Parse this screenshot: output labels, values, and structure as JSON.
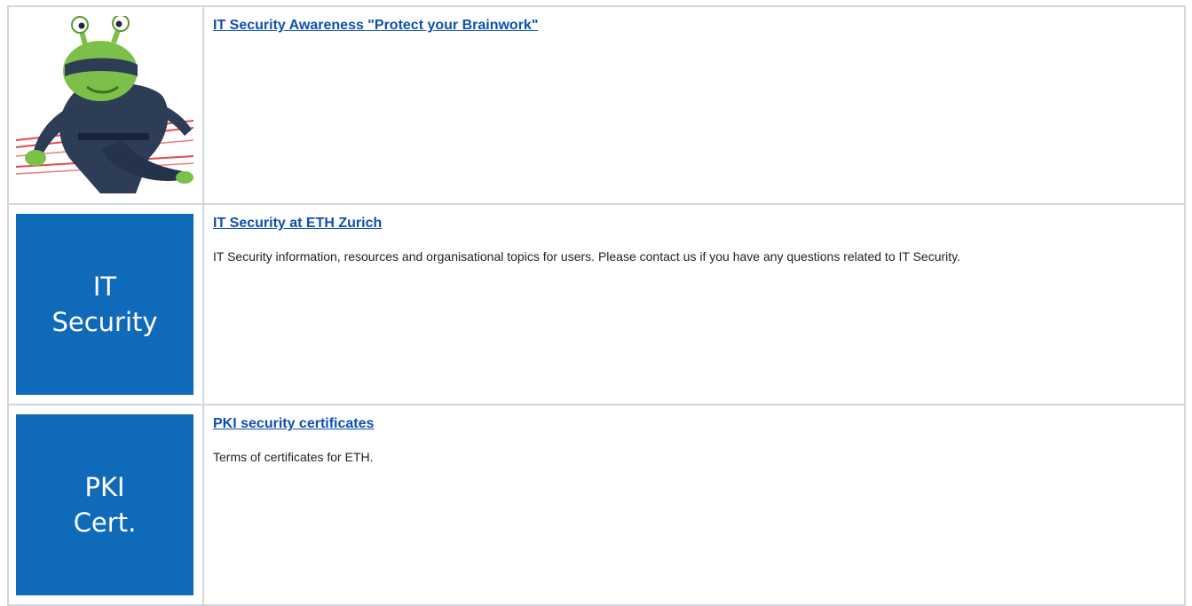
{
  "rows": [
    {
      "image": "ninja-alien-illustration",
      "title": "IT Security Awareness \"Protect your Brainwork\"",
      "description": ""
    },
    {
      "image": "it-security-tile",
      "tile_lines": [
        "IT",
        "Security"
      ],
      "title": "IT Security at ETH Zurich",
      "description": "IT Security information, resources and organisational topics for users. Please contact us if you have any questions related to IT Security."
    },
    {
      "image": "pki-cert-tile",
      "tile_lines": [
        "PKI",
        "Cert."
      ],
      "title": "PKI security certificates",
      "description": "Terms of certificates for ETH."
    }
  ],
  "colors": {
    "tile_blue": "#0f6aba",
    "link": "#0f4fb0",
    "border": "#d3d7dd"
  }
}
